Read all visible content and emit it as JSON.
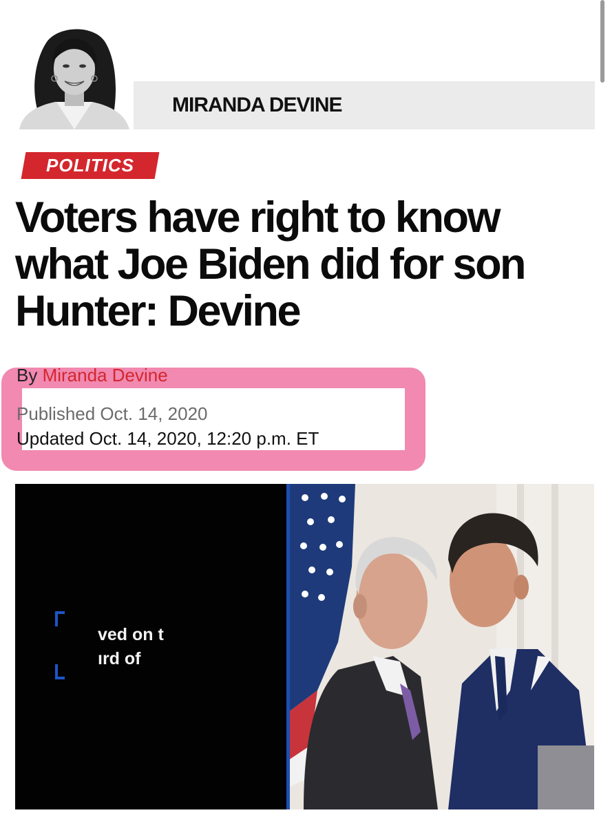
{
  "author": {
    "name": "MIRANDA DEVINE"
  },
  "article": {
    "section": "POLITICS",
    "headline_lines": [
      "Voters have right to know",
      "what Joe Biden did for son",
      "Hunter: Devine"
    ],
    "byline_prefix": "By",
    "byline_author": "Miranda Devine",
    "published": "Published Oct. 14, 2020",
    "updated": "Updated Oct. 14, 2020, 12:20 p.m. ET"
  },
  "hero_image": {
    "caption_fragments": [
      "ved on t",
      "ırd of"
    ]
  },
  "colors": {
    "accent_red": "#d3272d",
    "highlight_pink": "#eb5b91"
  }
}
